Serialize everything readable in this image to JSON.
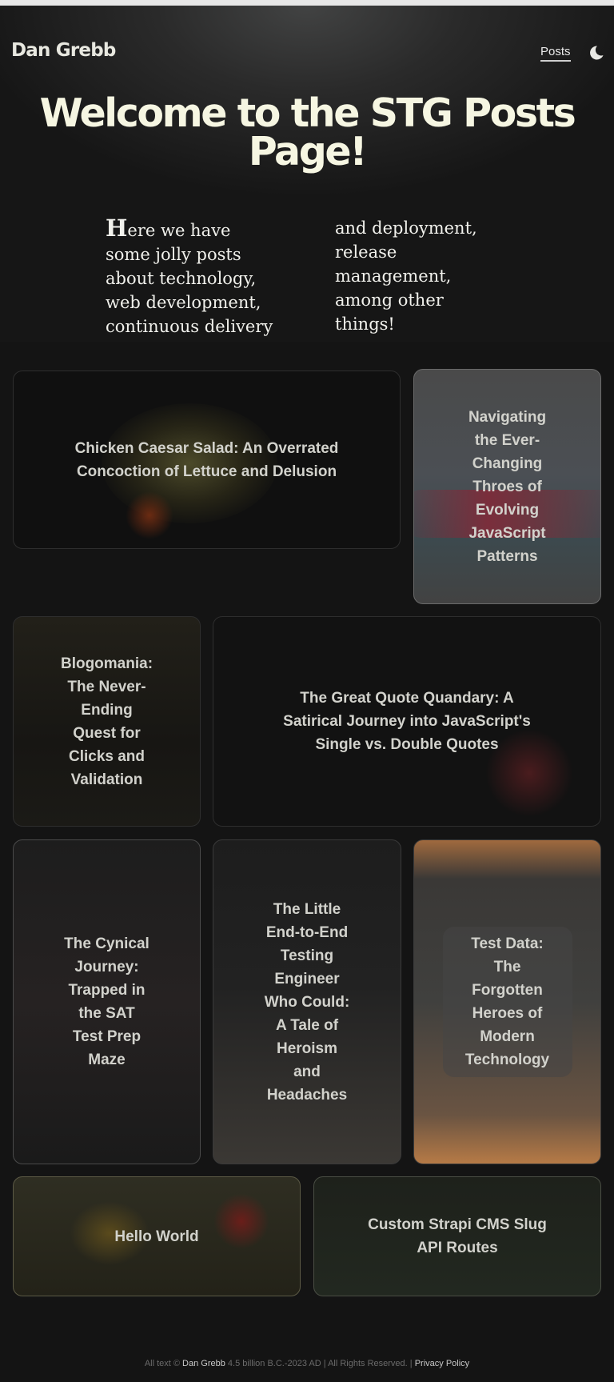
{
  "header": {
    "brand": "Dan Grebb",
    "nav_posts": "Posts",
    "theme_icon": "moon-icon"
  },
  "hero": {
    "title": "Welcome to the STG Posts Page!",
    "intro_first_letter": "H",
    "intro_rest": "ere we have some jolly posts about technology, web development, continuous delivery and deployment, release management, among other things!"
  },
  "posts": [
    {
      "title": "Chicken Caesar Salad: An Overrated Concoction of Lettuce and Delusion"
    },
    {
      "title": "Navigating the Ever-Changing Throes of Evolving JavaScript Patterns"
    },
    {
      "title": "Blogomania: The Never-Ending Quest for Clicks and Validation"
    },
    {
      "title": "The Great Quote Quandary: A Satirical Journey into JavaScript's Single vs. Double Quotes"
    },
    {
      "title": "The Cynical Journey: Trapped in the SAT Test Prep Maze"
    },
    {
      "title": "The Little End-to-End Testing Engineer Who Could: A Tale of Heroism and Headaches"
    },
    {
      "title": "Test Data: The Forgotten Heroes of Modern Technology"
    },
    {
      "title": "Hello World"
    },
    {
      "title": "Custom Strapi CMS Slug API Routes"
    }
  ],
  "footer": {
    "prefix": "All text ©",
    "author": "Dan Grebb",
    "range": "4.5 billion B.C.-2023 AD | All Rights Reserved. |",
    "privacy": "Privacy Policy"
  }
}
